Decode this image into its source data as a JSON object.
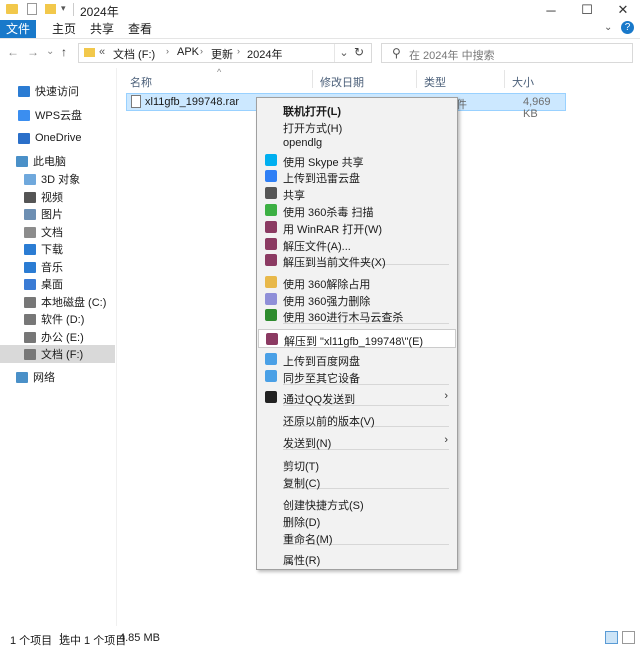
{
  "window": {
    "title": "2024年",
    "minimize_icon": "─",
    "maximize_icon": "☐",
    "close_icon": "✕",
    "help_icon": "?"
  },
  "ribbon": {
    "tabs": [
      "文件",
      "主页",
      "共享",
      "查看"
    ]
  },
  "nav": {
    "back": "←",
    "forward": "→",
    "recent": "⌄",
    "up": "↑",
    "breadcrumb": [
      "«",
      "文档 (F:)",
      "APK",
      "更新",
      "2024年"
    ],
    "refresh": "↻",
    "search_placeholder": "在 2024年 中搜索"
  },
  "sidebar": {
    "items": [
      {
        "label": "快速访问",
        "color": "#2b7cd3"
      },
      {
        "label": "WPS云盘",
        "color": "#3b8ef0"
      },
      {
        "label": "OneDrive",
        "color": "#2a6fc9"
      },
      {
        "label": "此电脑",
        "color": "#4a90c8"
      },
      {
        "label": "3D 对象",
        "color": "#6fa8dc"
      },
      {
        "label": "视频",
        "color": "#555555"
      },
      {
        "label": "图片",
        "color": "#6d8fb3"
      },
      {
        "label": "文档",
        "color": "#8c8c8c"
      },
      {
        "label": "下载",
        "color": "#2b7cd3"
      },
      {
        "label": "音乐",
        "color": "#2b7cd3"
      },
      {
        "label": "桌面",
        "color": "#3a7bd5"
      },
      {
        "label": "本地磁盘 (C:)",
        "color": "#777777"
      },
      {
        "label": "软件 (D:)",
        "color": "#777777"
      },
      {
        "label": "办公 (E:)",
        "color": "#777777"
      },
      {
        "label": "文档 (F:)",
        "color": "#777777"
      },
      {
        "label": "网络",
        "color": "#4a90c8"
      }
    ]
  },
  "columns": {
    "name": "名称",
    "date": "修改日期",
    "type": "类型",
    "size": "大小"
  },
  "file": {
    "name": "xl11gfb_199748.rar",
    "type_partial": "件",
    "size": "4,969 KB"
  },
  "context_menu": {
    "items": [
      {
        "label": "联机打开(L)",
        "bold": true
      },
      {
        "label": "打开方式(H)"
      },
      {
        "label": "opendlg"
      },
      {
        "label": "使用 Skype 共享",
        "icon": "skype-icon",
        "color": "#00aff0"
      },
      {
        "label": "上传到迅雷云盘",
        "icon": "thunder-cloud-icon",
        "color": "#2f7ff5"
      },
      {
        "label": "共享",
        "icon": "share-icon",
        "color": "#555555"
      },
      {
        "label": "使用 360杀毒 扫描",
        "icon": "360-antivirus-icon",
        "color": "#3cb043"
      },
      {
        "label": "用 WinRAR 打开(W)",
        "icon": "winrar-icon",
        "color": "#8b3a62"
      },
      {
        "label": "解压文件(A)...",
        "icon": "winrar-icon",
        "color": "#8b3a62"
      },
      {
        "label": "解压到当前文件夹(X)",
        "icon": "winrar-icon",
        "color": "#8b3a62"
      },
      {
        "label": "使用 360解除占用",
        "icon": "360-unlock-icon",
        "color": "#e8b84a"
      },
      {
        "label": "使用 360强力删除",
        "icon": "360-delete-icon",
        "color": "#8f8fd8"
      },
      {
        "label": "使用 360进行木马云查杀",
        "icon": "360-trojan-icon",
        "color": "#2e8b2e"
      },
      {
        "label": "解压到 \"xl11gfb_199748\\\"(E)",
        "icon": "winrar-icon",
        "color": "#8b3a62"
      },
      {
        "label": "上传到百度网盘",
        "icon": "baidu-netdisk-icon",
        "color": "#4aa0e6"
      },
      {
        "label": "同步至其它设备",
        "icon": "baidu-sync-icon",
        "color": "#4aa0e6"
      },
      {
        "label": "通过QQ发送到",
        "icon": "qq-icon",
        "color": "#222222"
      },
      {
        "label": "还原以前的版本(V)"
      },
      {
        "label": "发送到(N)"
      },
      {
        "label": "剪切(T)"
      },
      {
        "label": "复制(C)"
      },
      {
        "label": "创建快捷方式(S)"
      },
      {
        "label": "删除(D)"
      },
      {
        "label": "重命名(M)"
      },
      {
        "label": "属性(R)"
      }
    ],
    "submenu_arrow": "›"
  },
  "status": {
    "count": "1 个项目",
    "selected": "选中 1 个项目",
    "size": "4.85 MB"
  }
}
